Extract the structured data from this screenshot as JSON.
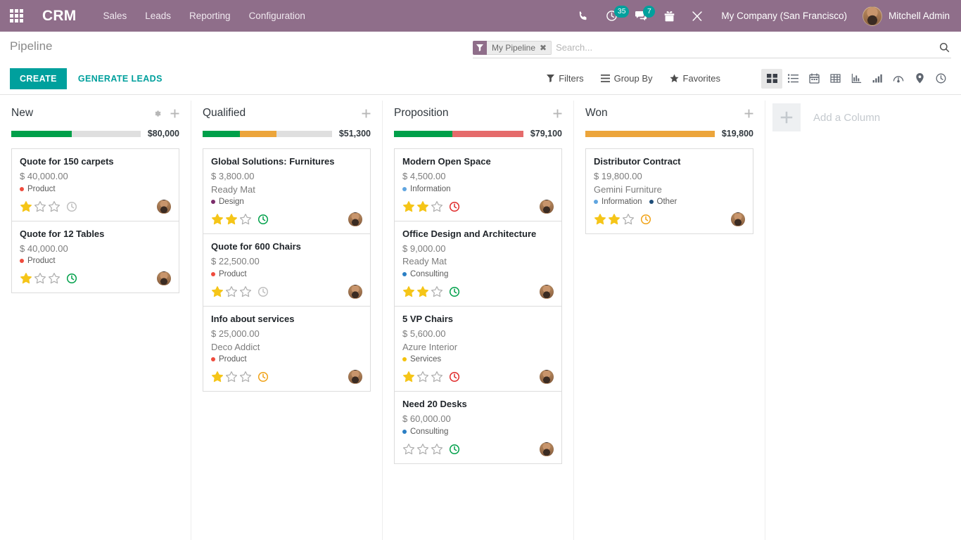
{
  "navbar": {
    "apps_icon": "apps-grid-icon",
    "brand": "CRM",
    "menu": [
      {
        "label": "Sales"
      },
      {
        "label": "Leads"
      },
      {
        "label": "Reporting"
      },
      {
        "label": "Configuration"
      }
    ],
    "icons": [
      {
        "name": "phone-icon",
        "badge": null
      },
      {
        "name": "activity-clock-icon",
        "badge": "35"
      },
      {
        "name": "messages-icon",
        "badge": "7"
      },
      {
        "name": "gift-icon",
        "badge": null
      },
      {
        "name": "tools-icon",
        "badge": null
      }
    ],
    "company": "My Company (San Francisco)",
    "user": "Mitchell Admin",
    "bg_color": "#8f6e8a",
    "badge_color": "#00a09d"
  },
  "control_panel": {
    "page_title": "Pipeline",
    "create_label": "CREATE",
    "generate_leads_label": "GENERATE LEADS",
    "accent_color": "#00a09d",
    "search": {
      "facet_label": "My Pipeline",
      "facet_remove": "✖",
      "placeholder": "Search..."
    },
    "filters": [
      {
        "label": "Filters",
        "icon": "filter-icon"
      },
      {
        "label": "Group By",
        "icon": "bars-icon"
      },
      {
        "label": "Favorites",
        "icon": "star-icon"
      }
    ],
    "views": [
      {
        "name": "kanban-view",
        "active": true
      },
      {
        "name": "list-view",
        "active": false
      },
      {
        "name": "calendar-view",
        "active": false
      },
      {
        "name": "pivot-view",
        "active": false
      },
      {
        "name": "graph-view",
        "active": false
      },
      {
        "name": "bar-chart-view",
        "active": false
      },
      {
        "name": "dashboard-view",
        "active": false
      },
      {
        "name": "map-view",
        "active": false
      },
      {
        "name": "activity-view",
        "active": false
      }
    ]
  },
  "kanban": {
    "add_column_label": "Add a Column",
    "columns": [
      {
        "title": "New",
        "amount": "$80,000",
        "has_settings": true,
        "progress": [
          {
            "color": "#00a04a",
            "pct": 47
          },
          {
            "color": "#dfdfdf",
            "pct": 53
          }
        ],
        "cards": [
          {
            "title": "Quote for 150 carpets",
            "price": "$ 40,000.00",
            "partner": null,
            "tags": [
              {
                "label": "Product",
                "color": "#ef4b3d"
              }
            ],
            "stars": 1,
            "activity": "none"
          },
          {
            "title": "Quote for 12 Tables",
            "price": "$ 40,000.00",
            "partner": null,
            "tags": [
              {
                "label": "Product",
                "color": "#ef4b3d"
              }
            ],
            "stars": 1,
            "activity": "planned"
          }
        ]
      },
      {
        "title": "Qualified",
        "amount": "$51,300",
        "has_settings": false,
        "progress": [
          {
            "color": "#00a04a",
            "pct": 29
          },
          {
            "color": "#eca53b",
            "pct": 28
          },
          {
            "color": "#dfdfdf",
            "pct": 43
          }
        ],
        "cards": [
          {
            "title": "Global Solutions: Furnitures",
            "price": "$ 3,800.00",
            "partner": "Ready Mat",
            "tags": [
              {
                "label": "Design",
                "color": "#7b2d6b"
              }
            ],
            "stars": 2,
            "activity": "planned"
          },
          {
            "title": "Quote for 600 Chairs",
            "price": "$ 22,500.00",
            "partner": null,
            "tags": [
              {
                "label": "Product",
                "color": "#ef4b3d"
              }
            ],
            "stars": 1,
            "activity": "none"
          },
          {
            "title": "Info about services",
            "price": "$ 25,000.00",
            "partner": "Deco Addict",
            "tags": [
              {
                "label": "Product",
                "color": "#ef4b3d"
              }
            ],
            "stars": 1,
            "activity": "today"
          }
        ]
      },
      {
        "title": "Proposition",
        "amount": "$79,100",
        "has_settings": false,
        "progress": [
          {
            "color": "#00a04a",
            "pct": 45
          },
          {
            "color": "#e56b6b",
            "pct": 55
          }
        ],
        "cards": [
          {
            "title": "Modern Open Space",
            "price": "$ 4,500.00",
            "partner": null,
            "tags": [
              {
                "label": "Information",
                "color": "#60a5e0"
              }
            ],
            "stars": 2,
            "activity": "overdue"
          },
          {
            "title": "Office Design and Architecture",
            "price": "$ 9,000.00",
            "partner": "Ready Mat",
            "tags": [
              {
                "label": "Consulting",
                "color": "#2b7fc4"
              }
            ],
            "stars": 2,
            "activity": "planned"
          },
          {
            "title": "5 VP Chairs",
            "price": "$ 5,600.00",
            "partner": "Azure Interior",
            "tags": [
              {
                "label": "Services",
                "color": "#f4c20d"
              }
            ],
            "stars": 1,
            "activity": "overdue"
          },
          {
            "title": "Need 20 Desks",
            "price": "$ 60,000.00",
            "partner": null,
            "tags": [
              {
                "label": "Consulting",
                "color": "#2b7fc4"
              }
            ],
            "stars": 0,
            "activity": "planned"
          }
        ]
      },
      {
        "title": "Won",
        "amount": "$19,800",
        "has_settings": false,
        "progress": [
          {
            "color": "#eca53b",
            "pct": 100
          }
        ],
        "cards": [
          {
            "title": "Distributor Contract",
            "price": "$ 19,800.00",
            "partner": "Gemini Furniture",
            "tags": [
              {
                "label": "Information",
                "color": "#60a5e0"
              },
              {
                "label": "Other",
                "color": "#1f4e79"
              }
            ],
            "stars": 2,
            "activity": "today"
          }
        ]
      }
    ]
  }
}
